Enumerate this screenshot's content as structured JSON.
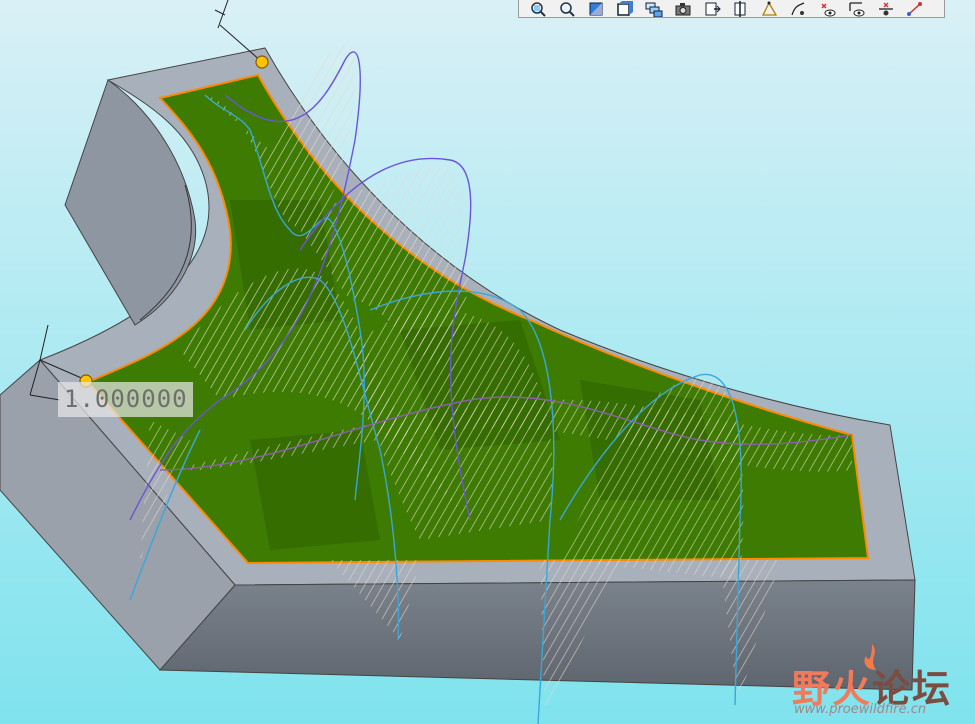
{
  "viewport": {
    "background_top": "#d8f0f6",
    "background_bottom": "#7ee3ef",
    "part_face": "#a9b0bb",
    "part_side": "#6f7781",
    "surface_fill": "#3c7a00",
    "surface_edge": "#ff8a00",
    "curvature_hatch": "#d8c6b6",
    "curve_color_cyan": "#2ab6e0",
    "curve_color_purple": "#6b55d8"
  },
  "dimension": {
    "value": "1.000000"
  },
  "toolbar": {
    "icons": [
      "zoom-fit-icon",
      "zoom-icon",
      "shade-icon",
      "view-box-icon",
      "layers-icon",
      "camera-icon",
      "datum-plane-icon",
      "datum-axis-icon",
      "curve-analysis-icon",
      "curvature-icon",
      "point-eye-icon",
      "section-eye-icon",
      "datum-point-icon",
      "connect-icon"
    ]
  },
  "watermark": {
    "part1": "野火",
    "part2": "论坛",
    "url": "www.proewildfire.cn"
  }
}
